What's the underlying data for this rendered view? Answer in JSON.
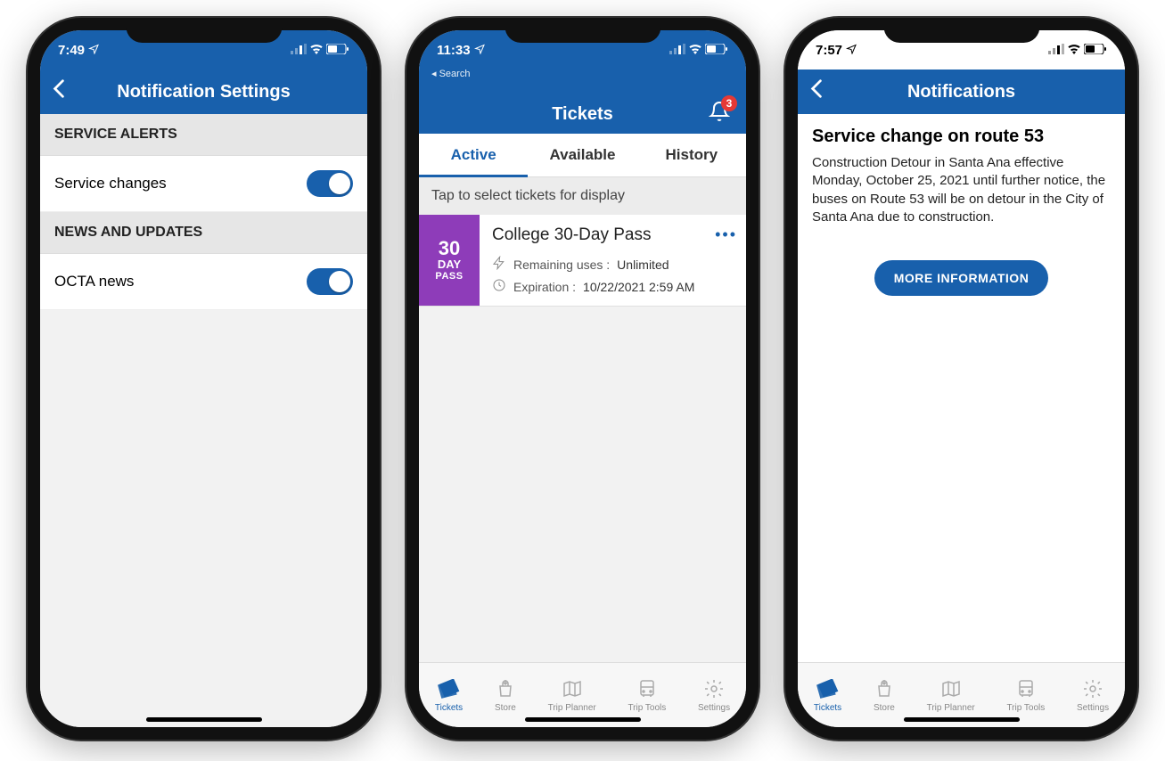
{
  "phone1": {
    "status_time": "7:49",
    "header_title": "Notification Settings",
    "section_alerts": "SERVICE ALERTS",
    "row_service_changes": "Service changes",
    "section_news": "NEWS AND UPDATES",
    "row_octa_news": "OCTA news"
  },
  "phone2": {
    "status_time": "11:33",
    "status_sub": "Search",
    "header_title": "Tickets",
    "badge_count": "3",
    "tabs": {
      "active": "Active",
      "available": "Available",
      "history": "History"
    },
    "hint": "Tap to select tickets for display",
    "ticket": {
      "side_num": "30",
      "side_day": "DAY",
      "side_pass": "PASS",
      "title": "College 30-Day Pass",
      "uses_label": "Remaining uses :",
      "uses_value": "Unlimited",
      "exp_label": "Expiration :",
      "exp_value": "10/22/2021 2:59 AM"
    },
    "nav": {
      "tickets": "Tickets",
      "store": "Store",
      "trip_planner": "Trip Planner",
      "trip_tools": "Trip Tools",
      "settings": "Settings"
    }
  },
  "phone3": {
    "status_time": "7:57",
    "header_title": "Notifications",
    "notif_title": "Service change on route 53",
    "notif_body": "Construction Detour in Santa Ana effective Monday, October 25, 2021 until further notice, the buses on Route 53 will be on detour in the City of Santa Ana due to construction.",
    "button": "MORE INFORMATION",
    "nav": {
      "tickets": "Tickets",
      "store": "Store",
      "trip_planner": "Trip Planner",
      "trip_tools": "Trip Tools",
      "settings": "Settings"
    }
  }
}
